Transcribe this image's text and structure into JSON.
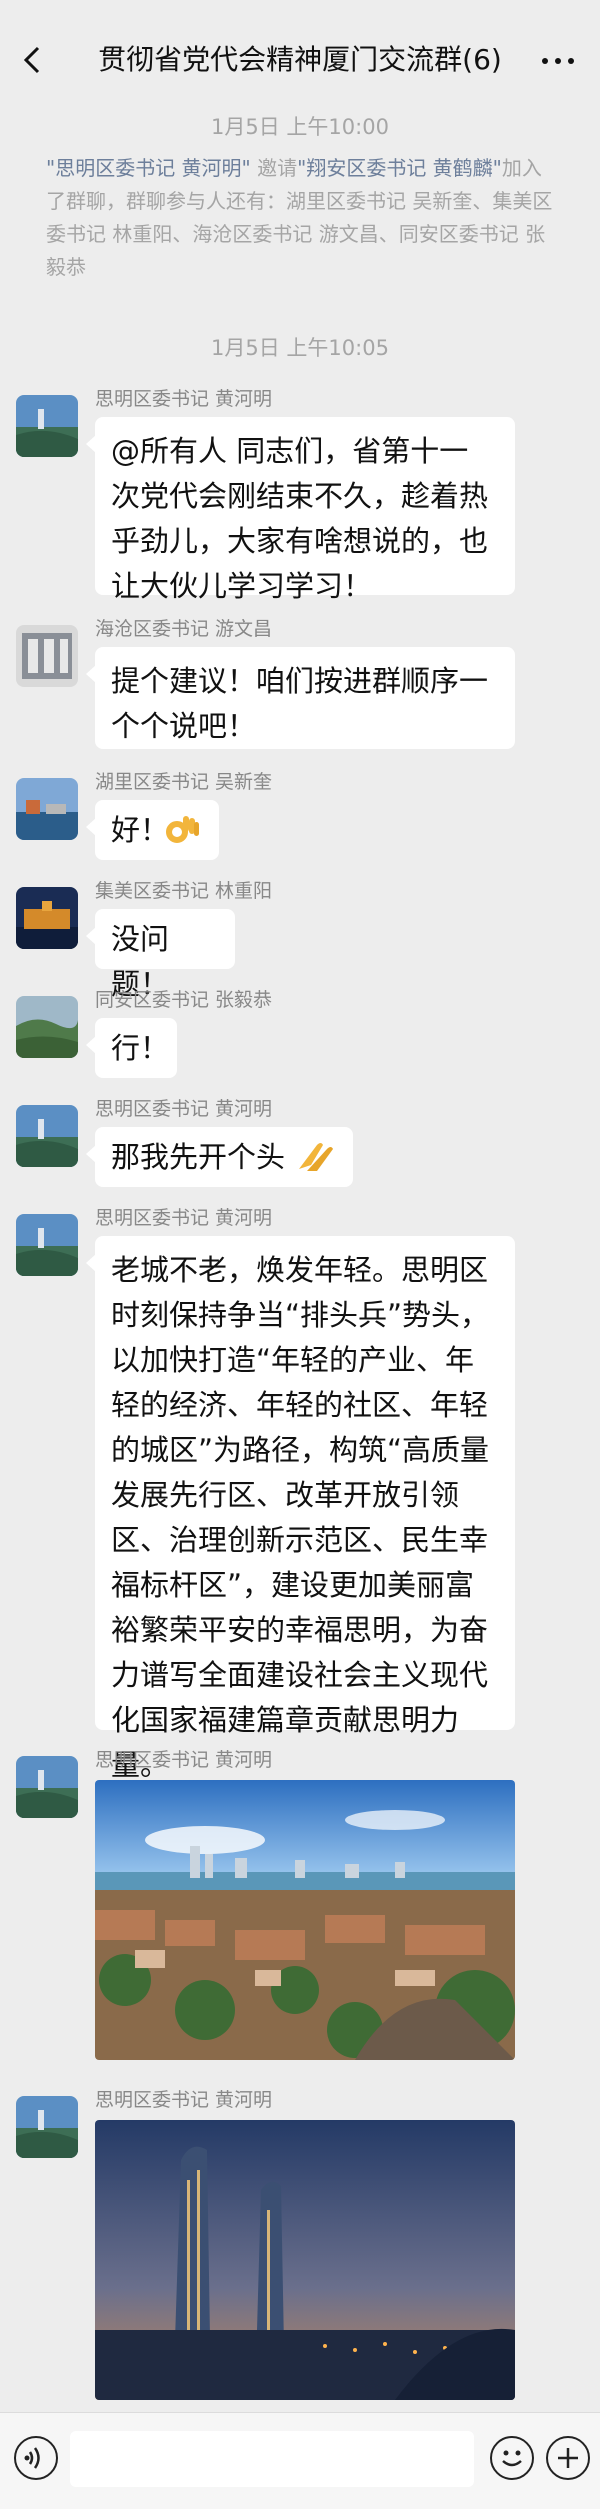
{
  "header": {
    "title": "贯彻省党代会精神厦门交流群(6)"
  },
  "times": [
    "1月5日 上午10:00",
    "1月5日 上午10:05"
  ],
  "system": {
    "inviter": "\"思明区委书记 黄河明\"",
    "invite_word": "邀请",
    "invitee": "\"翔安区委书记 黄鹤麟\"",
    "rest": "加入了群聊，群聊参与人还有：湖里区委书记 吴新奎、集美区委书记 林重阳、海沧区委书记 游文昌、同安区委书记 张毅恭"
  },
  "messages": [
    {
      "sender": "思明区委书记 黄河明",
      "text": "@所有人 同志们，省第十一次党代会刚结束不久，趁着热乎劲儿，大家有啥想说的，也让大伙儿学习学习！"
    },
    {
      "sender": "海沧区委书记 游文昌",
      "text": "提个建议！咱们按进群顺序一个个说吧！"
    },
    {
      "sender": "湖里区委书记 吴新奎",
      "text": "好！",
      "emoji": "ok-hand"
    },
    {
      "sender": "集美区委书记 林重阳",
      "text": "没问题！"
    },
    {
      "sender": "同安区委书记 张毅恭",
      "text": "行！"
    },
    {
      "sender": "思明区委书记 黄河明",
      "text": "那我先开个头",
      "emoji": "clap"
    },
    {
      "sender": "思明区委书记 黄河明",
      "text": "老城不老，焕发年轻。思明区时刻保持争当“排头兵”势头，以加快打造“年轻的产业、年轻的经济、年轻的社区、年轻的城区”为路径，构筑“高质量发展先行区、改革开放引领区、治理创新示范区、民生幸福标杆区”，建设更加美丽富裕繁荣平安的幸福思明，为奋力谱写全面建设社会主义现代化国家福建篇章贡献思明力量。"
    },
    {
      "sender": "思明区委书记 黄河明",
      "image": "city-skyline-photo"
    },
    {
      "sender": "思明区委书记 黄河明",
      "image": "night-towers-photo"
    }
  ],
  "colors": {
    "background": "#ededed",
    "bubble": "#ffffff",
    "meta_text": "#a5a5a5",
    "quote_text": "#6d7f9b"
  }
}
